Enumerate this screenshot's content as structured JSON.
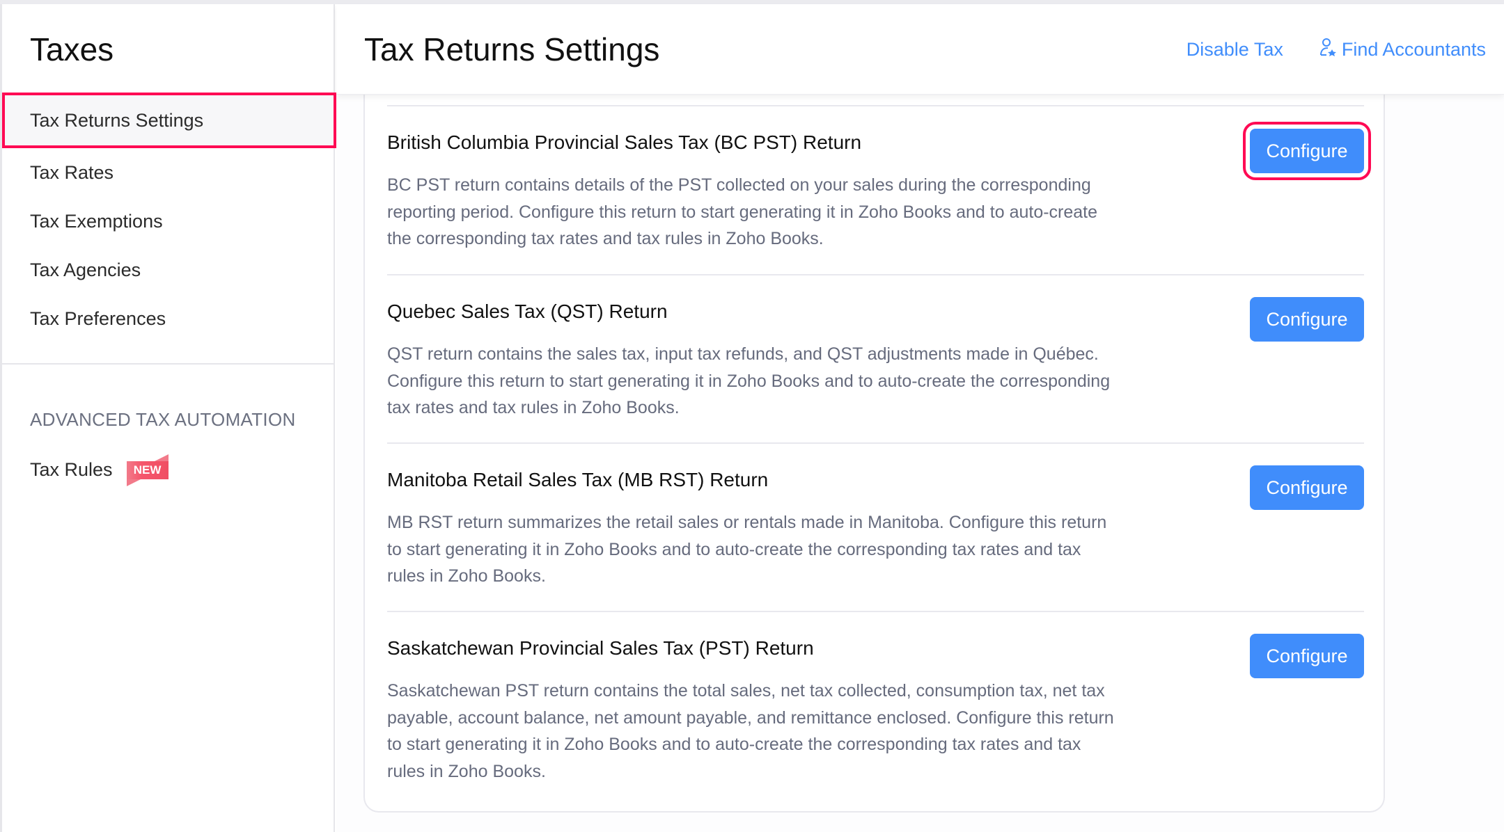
{
  "sidebar": {
    "title": "Taxes",
    "items": [
      {
        "label": "Tax Returns Settings",
        "active": true
      },
      {
        "label": "Tax Rates"
      },
      {
        "label": "Tax Exemptions"
      },
      {
        "label": "Tax Agencies"
      },
      {
        "label": "Tax Preferences"
      }
    ],
    "section_label": "ADVANCED TAX AUTOMATION",
    "tax_rules": {
      "label": "Tax Rules",
      "badge": "NEW"
    }
  },
  "header": {
    "title": "Tax Returns Settings",
    "actions": {
      "disable_tax": "Disable Tax",
      "find_accountants": "Find Accountants",
      "find_accountants_icon": "user-star-icon"
    }
  },
  "returns": [
    {
      "title": "British Columbia Provincial Sales Tax (BC PST) Return",
      "description": "BC PST return contains details of the PST collected on your sales during the corresponding reporting period. Configure this return to start generating it in Zoho Books and to auto-create the corresponding tax rates and tax rules in Zoho Books.",
      "button": "Configure"
    },
    {
      "title": "Quebec Sales Tax (QST) Return",
      "description": "QST return contains the sales tax, input tax refunds, and QST adjustments made in Québec. Configure this return to start generating it in Zoho Books and to auto-create the corresponding tax rates and tax rules in Zoho Books.",
      "button": "Configure"
    },
    {
      "title": "Manitoba Retail Sales Tax (MB RST) Return",
      "description": "MB RST return summarizes the retail sales or rentals made in Manitoba. Configure this return to start generating it in Zoho Books and to auto-create the corresponding tax rates and tax rules in Zoho Books.",
      "button": "Configure"
    },
    {
      "title": "Saskatchewan Provincial Sales Tax (PST) Return",
      "description": "Saskatchewan PST return contains the total sales, net tax collected, consumption tax, net tax payable, account balance, net amount payable, and remittance enclosed. Configure this return to start generating it in Zoho Books and to auto-create the corresponding tax rates and tax rules in Zoho Books.",
      "button": "Configure"
    }
  ],
  "colors": {
    "accent": "#408dfb",
    "highlight": "#ff0a54",
    "badge": "#f5576c"
  }
}
